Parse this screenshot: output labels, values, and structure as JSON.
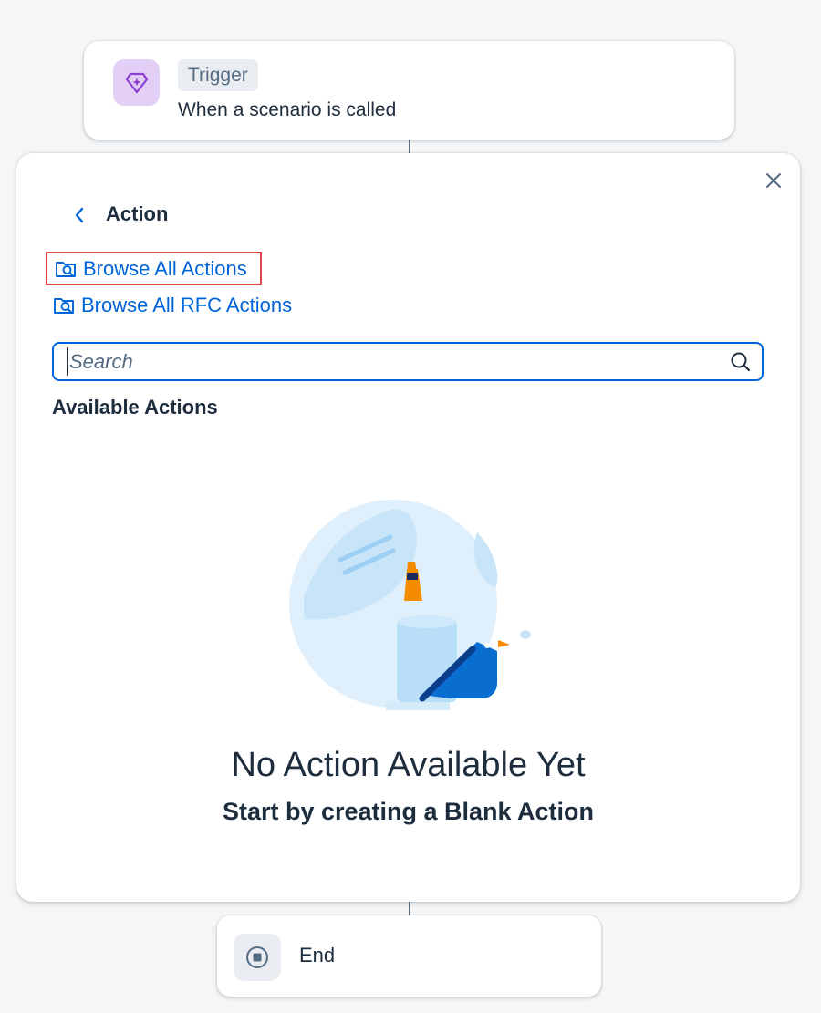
{
  "trigger": {
    "tag": "Trigger",
    "description": "When a scenario is called",
    "icon": "diamond-sparkle-icon",
    "icon_bg_color": "#e3cff5",
    "icon_color": "#8b3fd1"
  },
  "action_panel": {
    "title": "Action",
    "links": [
      {
        "label": "Browse All Actions",
        "icon": "browse-folder-search-icon"
      },
      {
        "label": "Browse All RFC Actions",
        "icon": "browse-folder-search-icon"
      }
    ],
    "search": {
      "value": "",
      "placeholder": "Search"
    },
    "section_title": "Available Actions",
    "empty_state": {
      "title": "No Action Available Yet",
      "subtitle": "Start by creating a Blank Action"
    }
  },
  "end": {
    "label": "End",
    "icon": "stop-circle-icon"
  },
  "colors": {
    "link": "#0064d9",
    "text": "#1d2d3e",
    "highlight_border": "#e0454a",
    "background": "#f5f6f7"
  }
}
